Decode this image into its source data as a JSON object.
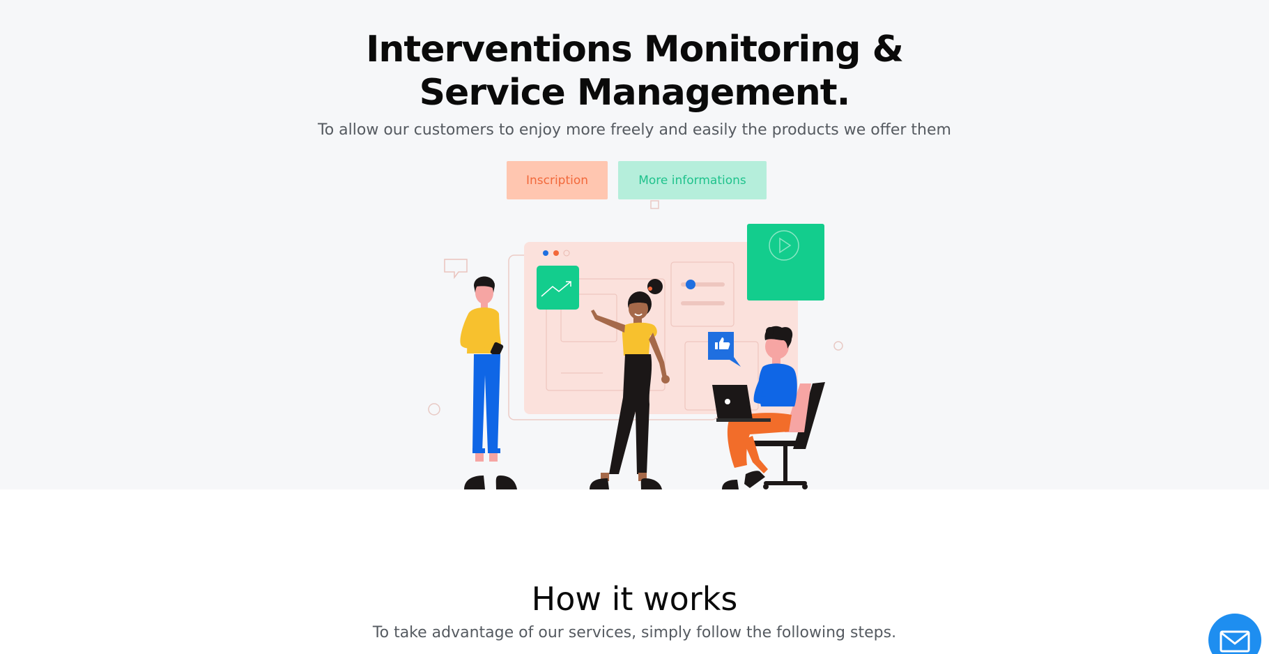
{
  "hero": {
    "title_line1": "Interventions Monitoring &",
    "title_line2": "Service Management.",
    "subtitle": "To allow our customers to enjoy more freely and easily the products we offer them",
    "buttons": {
      "inscription": "Inscription",
      "more": "More informations"
    },
    "illustration_icons": [
      "trend-chart-icon",
      "play-icon",
      "thumbs-up-icon",
      "speech-bubble-icon",
      "laptop-icon",
      "phone-icon"
    ]
  },
  "how_it_works": {
    "title": "How it works",
    "subtitle": "To take advantage of our services, simply follow the following steps."
  },
  "contact": {
    "icon": "envelope-icon"
  },
  "colors": {
    "accent_orange": "#f2683a",
    "accent_orange_bg": "#ffc6b0",
    "accent_green": "#13cd8d",
    "accent_green_bg": "#b5eedb",
    "accent_blue": "#1e8ef0",
    "hero_bg": "#f6f7f9"
  }
}
